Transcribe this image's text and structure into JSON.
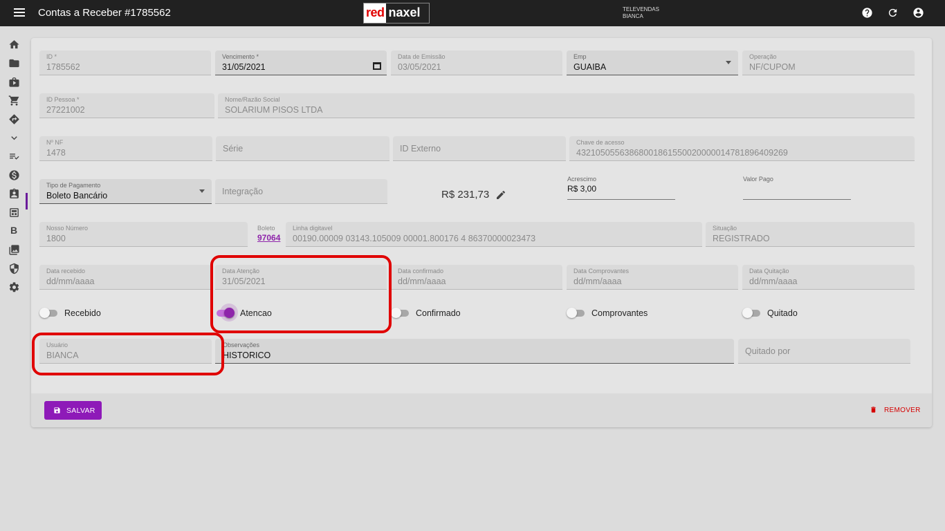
{
  "header": {
    "title": "Contas a Receber #1785562",
    "logo_part1": "red",
    "logo_part2": "naxel",
    "company_line1": "TELEVENDAS",
    "company_line2": "BIANCA",
    "icons": [
      "help-icon",
      "refresh-icon",
      "account-icon"
    ]
  },
  "sidebar": {
    "icons": [
      "home-icon",
      "folder-icon",
      "briefcase-icon",
      "cart-icon",
      "directions-icon",
      "chevron-down-icon",
      "checklist-icon",
      "dollar-icon",
      "clipboard-account-icon",
      "calculator-icon",
      "bold-b-icon",
      "image-stack-icon",
      "shield-icon",
      "gear-icon"
    ],
    "b_label": "B",
    "active": "dollar-icon"
  },
  "form": {
    "id": {
      "label": "ID *",
      "value": "1785562"
    },
    "vencimento": {
      "label": "Vencimento *",
      "value": "31/05/2021"
    },
    "emissao": {
      "label": "Data de Emissão",
      "value": "03/05/2021"
    },
    "emp": {
      "label": "Emp",
      "value": "GUAIBA"
    },
    "operacao": {
      "label": "Operação",
      "value": "NF/CUPOM"
    },
    "id_pessoa": {
      "label": "ID Pessoa *",
      "value": "27221002"
    },
    "nome": {
      "label": "Nome/Razão Social",
      "value": "SOLARIUM PISOS LTDA"
    },
    "nf": {
      "label": "Nº NF",
      "value": "1478"
    },
    "serie": {
      "placeholder": "Série"
    },
    "id_externo": {
      "placeholder": "ID Externo"
    },
    "chave": {
      "label": "Chave de acesso",
      "value": "43210505563868001861550020000014781896409269"
    },
    "tipo_pagamento": {
      "label": "Tipo de Pagamento",
      "value": "Boleto Bancário"
    },
    "integracao": {
      "placeholder": "Integração"
    },
    "valor": "R$ 231,73",
    "acrescimo": {
      "label": "Acrescimo",
      "value": "R$ 3,00"
    },
    "valor_pago": {
      "label": "Valor Pago",
      "value": ""
    },
    "nosso_numero": {
      "label": "Nosso Número",
      "value": "1800"
    },
    "boleto": {
      "label": "Boleto",
      "value": "97064"
    },
    "linha_digitavel": {
      "label": "Linha digitavel",
      "value": "00190.00009 03143.105009 00001.800176 4 86370000023473"
    },
    "situacao": {
      "label": "Situação",
      "value": "REGISTRADO"
    },
    "data_recebido": {
      "label": "Data recebido",
      "value": "dd/mm/aaaa"
    },
    "data_atencao": {
      "label": "Data Atenção",
      "value": "31/05/2021"
    },
    "data_confirmado": {
      "label": "Data confirmado",
      "value": "dd/mm/aaaa"
    },
    "data_comprovantes": {
      "label": "Data Comprovantes",
      "value": "dd/mm/aaaa"
    },
    "data_quitacao": {
      "label": "Data Quitação",
      "value": "dd/mm/aaaa"
    },
    "toggles": {
      "recebido": {
        "label": "Recebido",
        "on": false
      },
      "atencao": {
        "label": "Atencao",
        "on": true
      },
      "confirmado": {
        "label": "Confirmado",
        "on": false
      },
      "comprovantes": {
        "label": "Comprovantes",
        "on": false
      },
      "quitado": {
        "label": "Quitado",
        "on": false
      }
    },
    "usuario": {
      "label": "Usuário",
      "value": "BIANCA"
    },
    "observacoes": {
      "label": "Observações",
      "value": "HISTORICO"
    },
    "quitado_por": {
      "placeholder": "Quitado por"
    }
  },
  "actions": {
    "save_label": "SALVAR",
    "remove_label": "REMOVER"
  },
  "colors": {
    "accent": "#8e24aa",
    "topbar": "#212121",
    "highlight": "#e00000",
    "remove": "#d50000"
  }
}
